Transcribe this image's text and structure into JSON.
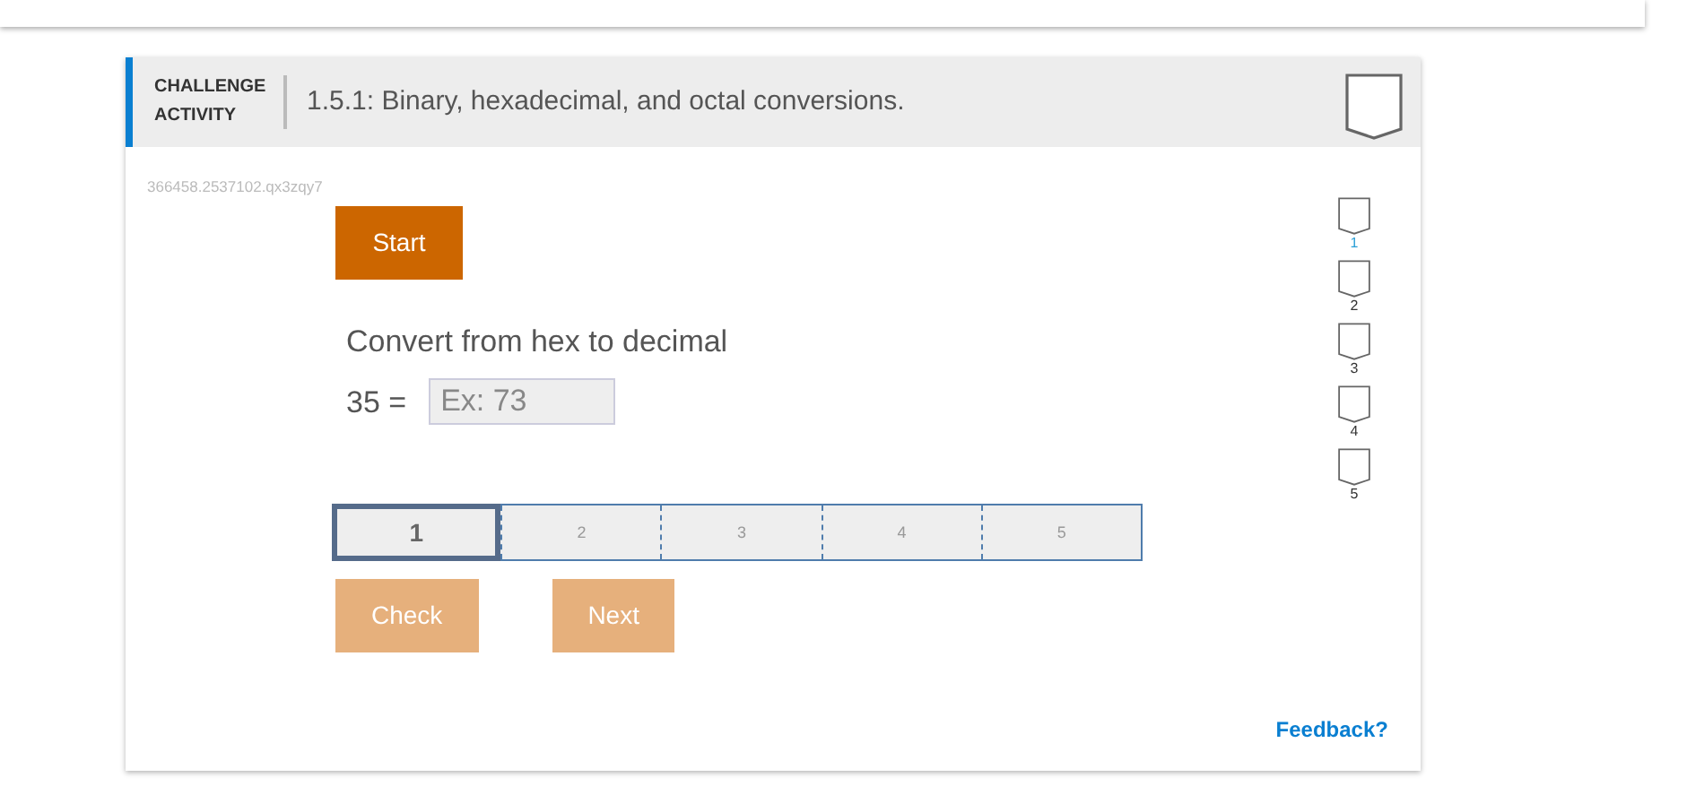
{
  "activity": {
    "label": "CHALLENGE ACTIVITY",
    "title": "1.5.1: Binary, hexadecimal, and octal conversions.",
    "completed": false
  },
  "activity_id": "366458.2537102.qx3zqy7",
  "start_button": "Start",
  "prompt": "Convert from hex to decimal",
  "question": {
    "expression": "35 =",
    "placeholder": "Ex: 73"
  },
  "levels": [
    {
      "label": "1",
      "selected": true
    },
    {
      "label": "2",
      "selected": false
    },
    {
      "label": "3",
      "selected": false
    },
    {
      "label": "4",
      "selected": false
    },
    {
      "label": "5",
      "selected": false
    }
  ],
  "buttons": [
    {
      "label": "Check",
      "disabled": true
    },
    {
      "label": "Next",
      "disabled": true
    }
  ],
  "level_badges": [
    {
      "label": "1",
      "selected": true,
      "completed": false
    },
    {
      "label": "2",
      "selected": false,
      "completed": false
    },
    {
      "label": "3",
      "selected": false,
      "completed": false
    },
    {
      "label": "4",
      "selected": false,
      "completed": false
    },
    {
      "label": "5",
      "selected": false,
      "completed": false
    }
  ],
  "feedback_link": "Feedback?"
}
